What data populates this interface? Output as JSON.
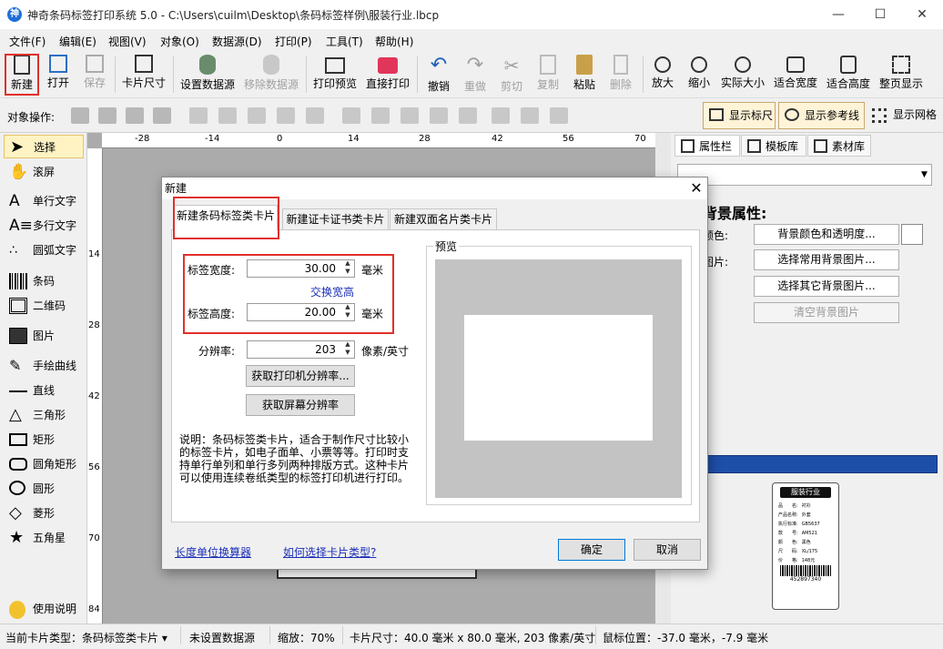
{
  "window": {
    "title": "神奇条码标签打印系统 5.0 - C:\\Users\\cuilm\\Desktop\\条码标签样例\\服装行业.lbcp",
    "minimize": "—",
    "maximize": "☐",
    "close": "✕"
  },
  "menu": [
    "文件(F)",
    "编辑(E)",
    "视图(V)",
    "对象(O)",
    "数据源(D)",
    "打印(P)",
    "工具(T)",
    "帮助(H)"
  ],
  "toolbar": [
    "新建",
    "打开",
    "保存",
    "卡片尺寸",
    "设置数据源",
    "移除数据源",
    "打印预览",
    "直接打印",
    "撤销",
    "重做",
    "剪切",
    "复制",
    "粘贴",
    "删除",
    "放大",
    "缩小",
    "实际大小",
    "适合宽度",
    "适合高度",
    "整页显示"
  ],
  "toolbar2": {
    "label": "对象操作:",
    "show_ruler": "显示标尺",
    "show_guides": "显示参考线",
    "show_grid": "显示网格"
  },
  "tools": [
    "选择",
    "滚屏",
    "单行文字",
    "多行文字",
    "圆弧文字",
    "条码",
    "二维码",
    "图片",
    "手绘曲线",
    "直线",
    "三角形",
    "矩形",
    "圆角矩形",
    "圆形",
    "菱形",
    "五角星",
    "使用说明"
  ],
  "ruler": {
    "h": [
      "-28",
      "-14",
      "0",
      "14",
      "28",
      "42",
      "56",
      "70"
    ],
    "v": [
      "14",
      "28",
      "42",
      "56",
      "70",
      "84"
    ]
  },
  "right_panel": {
    "tabs": [
      "属性栏",
      "模板库",
      "素材库"
    ],
    "heading": "背景属性:",
    "color_label": "颜色:",
    "image_label": "图片:",
    "btn_color": "背景颜色和透明度...",
    "btn_common_img": "选择常用背景图片...",
    "btn_other_img": "选择其它背景图片...",
    "btn_clear_img": "清空背景图片",
    "thumb_title": "服装行业",
    "thumb_rows": [
      [
        "品　　名:",
        "衬衫"
      ],
      [
        "产品名称:",
        "外套"
      ],
      [
        "执行标准:",
        "GB5637"
      ],
      [
        "款　　号:",
        "AM521"
      ],
      [
        "颜　　色:",
        "黑色"
      ],
      [
        "尺　　码:",
        "XL/175"
      ],
      [
        "价　　格:",
        "148元"
      ]
    ],
    "thumb_barcode": "452897340"
  },
  "dialog": {
    "title": "新建",
    "close": "✕",
    "tabs": [
      "新建条码标签类卡片",
      "新建证卡证书类卡片",
      "新建双面名片类卡片"
    ],
    "width_label": "标签宽度:",
    "width_value": "30.00",
    "height_label": "标签高度:",
    "height_value": "20.00",
    "unit_mm": "毫米",
    "swap_link": "交换宽高",
    "dpi_label": "分辨率:",
    "dpi_value": "203",
    "dpi_unit": "像素/英寸",
    "btn_printer_dpi": "获取打印机分辨率...",
    "btn_screen_dpi": "获取屏幕分辨率",
    "desc": "说明：条码标签类卡片，适合于制作尺寸比较小的标签卡片，如电子面单、小票等等。打印时支持单行单列和单行多列两种排版方式。这种卡片可以使用连续卷纸类型的标签打印机进行打印。",
    "preview_label": "预览",
    "link_converter": "长度单位换算器",
    "link_howto": "如何选择卡片类型?",
    "ok": "确定",
    "cancel": "取消"
  },
  "status": {
    "card_type": "当前卡片类型：条码标签类卡片 ▾",
    "datasource": "未设置数据源",
    "zoom": "缩放：70%",
    "card_size": "卡片尺寸：40.0 毫米 x 80.0 毫米, 203 像素/英寸",
    "mouse": "鼠标位置：-37.0 毫米，-7.9 毫米"
  }
}
